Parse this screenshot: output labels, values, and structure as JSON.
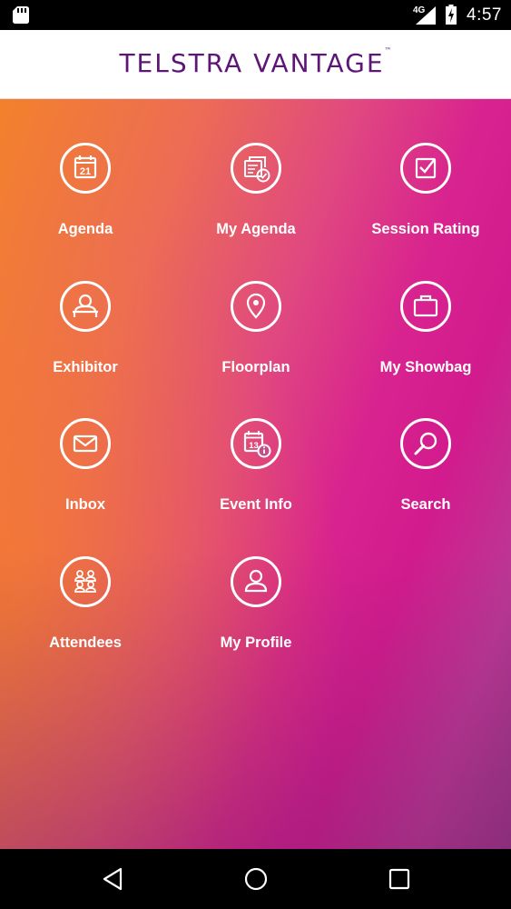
{
  "status_bar": {
    "network": "4G",
    "time": "4:57"
  },
  "header": {
    "title": "TELSTRA VANTAGE",
    "trademark": "™"
  },
  "menu": [
    {
      "label": "Agenda",
      "icon": "calendar-21-icon"
    },
    {
      "label": "My Agenda",
      "icon": "my-agenda-icon"
    },
    {
      "label": "Session Rating",
      "icon": "checkbox-icon"
    },
    {
      "label": "Exhibitor",
      "icon": "exhibitor-icon"
    },
    {
      "label": "Floorplan",
      "icon": "map-pin-icon"
    },
    {
      "label": "My Showbag",
      "icon": "bag-icon"
    },
    {
      "label": "Inbox",
      "icon": "envelope-icon"
    },
    {
      "label": "Event Info",
      "icon": "event-info-icon"
    },
    {
      "label": "Search",
      "icon": "search-icon"
    },
    {
      "label": "Attendees",
      "icon": "attendees-icon"
    },
    {
      "label": "My Profile",
      "icon": "profile-icon"
    }
  ],
  "icon_text": {
    "calendar_day": "21",
    "event_day": "13"
  },
  "colors": {
    "brand": "#5d1677",
    "gradient_orange": "#f3812c",
    "gradient_magenta": "#d21b8e"
  }
}
